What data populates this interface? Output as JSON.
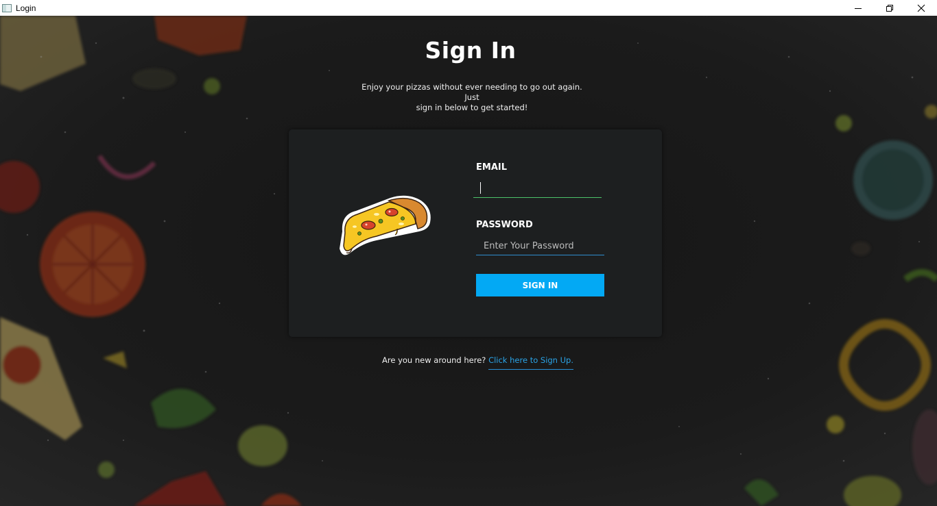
{
  "window": {
    "title": "Login",
    "icons": [
      "app-icon",
      "minimize-icon",
      "restore-icon",
      "close-icon"
    ]
  },
  "header": {
    "title": "Sign In",
    "subtitle_line1": "Enjoy your pizzas without ever needing to go out again. Just",
    "subtitle_line2": "sign in below to get started!"
  },
  "form": {
    "email_label": "EMAIL",
    "email_value": "",
    "password_label": "PASSWORD",
    "password_placeholder": "Enter Your Password",
    "submit_label": "SIGN IN",
    "illustration": "pizza-slice-icon"
  },
  "footer": {
    "prompt": "Are you new around here?",
    "link": "Click here to Sign Up."
  },
  "colors": {
    "accent": "#03a9f4",
    "email_underline": "#4cc36a",
    "link": "#2aa4e8",
    "card_bg": "#1d1f20",
    "page_bg": "#141414"
  }
}
